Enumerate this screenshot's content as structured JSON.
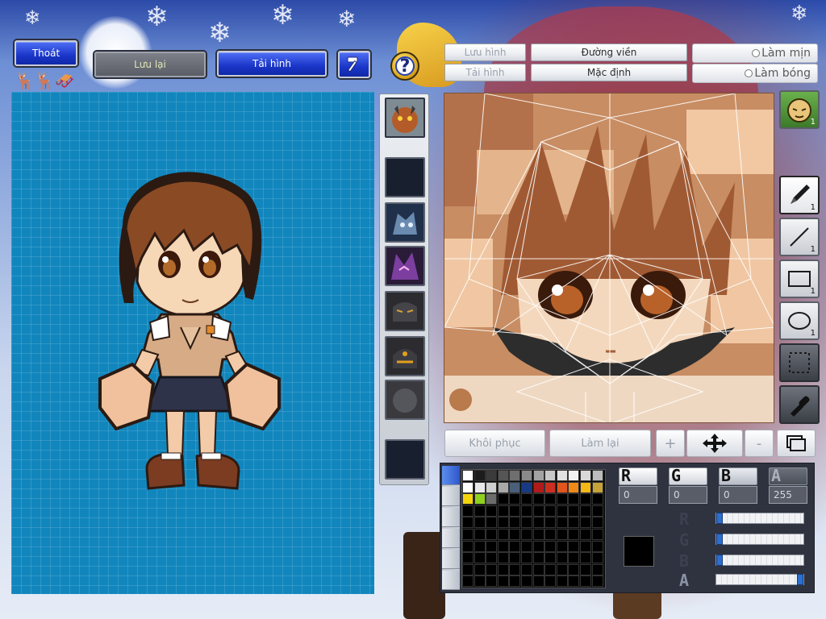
{
  "toolbar": {
    "exit_label": "Thoát",
    "save_label": "Lưu lại",
    "reload_label": "Tải hình",
    "hammer_icon": "hammer-icon",
    "help_icon": "question-icon"
  },
  "face_panel": {
    "save_image_label": "Lưu hình",
    "load_image_label": "Tải hình",
    "outline_label": "Đường viền",
    "default_label": "Mặc định",
    "smooth_label": "Làm mịn",
    "shine_label": "Làm bóng"
  },
  "edit_controls": {
    "restore_label": "Khôi phục",
    "redo_label": "Làm lại",
    "zoom_in_label": "+",
    "zoom_out_label": "-"
  },
  "tools": {
    "pen_count": "1",
    "line_count": "1",
    "rect_count": "1",
    "ellipse_count": "1",
    "face_count": "1"
  },
  "color": {
    "r_label": "R",
    "g_label": "G",
    "b_label": "B",
    "a_label": "A",
    "r_value": "0",
    "g_value": "0",
    "b_value": "0",
    "a_value": "255",
    "r_fraction": 0.0,
    "g_fraction": 0.0,
    "b_fraction": 0.0,
    "a_fraction": 1.0,
    "current_hex": "#000000",
    "palette_row1": [
      "#ffffff",
      "#1c1c1c",
      "#3b3b3b",
      "#555555",
      "#6f6f6f",
      "#8a8a8a",
      "#a3a3a3",
      "#c8c8c8",
      "#e1e1e1",
      "#f2f2f2",
      "#d8d8d8",
      "#bcbcbc"
    ],
    "palette_row2": [
      "#ffffff",
      "#e8e8e8",
      "#cfcfcf",
      "#a9a9a9",
      "#4a5f7a",
      "#173a82",
      "#b11a1a",
      "#cc2f1f",
      "#e0561c",
      "#ee8a18",
      "#f2b917",
      "#c7a43a"
    ],
    "palette_row3": [
      "#f4d40a",
      "#8fd11c",
      "#6c6c6c"
    ]
  }
}
